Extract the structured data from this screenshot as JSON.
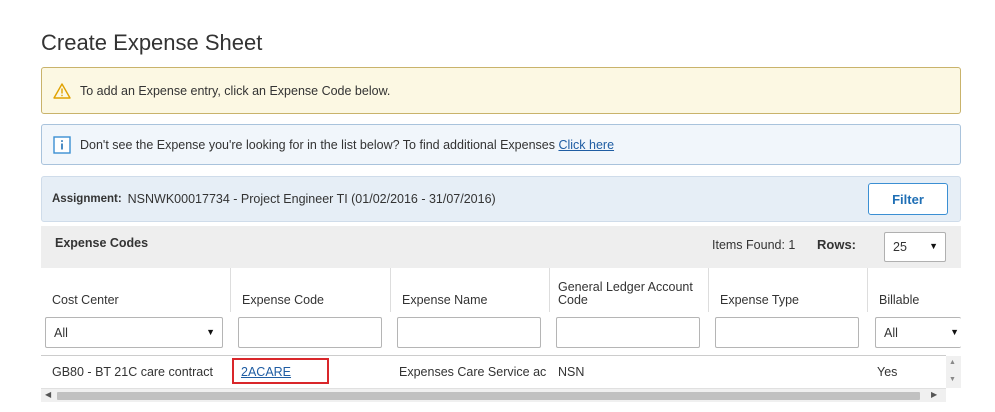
{
  "page_title": "Create Expense Sheet",
  "warning": {
    "icon": "warning-triangle-icon",
    "text": "To add an Expense entry, click an Expense Code below."
  },
  "info": {
    "icon": "info-icon",
    "text": "Don't see the Expense you're looking for in the list below? To find additional Expenses",
    "link": "Click here"
  },
  "assignment": {
    "label": "Assignment:",
    "value": "NSNWK00017734 - Project Engineer TI (01/02/2016 - 31/07/2016)",
    "filter_button": "Filter"
  },
  "codes": {
    "title": "Expense Codes",
    "items_found": "Items Found:  1",
    "rows_label": "Rows:",
    "rows_value": "25"
  },
  "columns": [
    "Cost Center",
    "Expense Code",
    "Expense Name",
    "General Ledger Account Code",
    "Expense Type",
    "Billable"
  ],
  "filters": {
    "cost_center": "All",
    "billable": "All"
  },
  "rows": [
    {
      "cost_center": "GB80 - BT 21C care contract",
      "expense_code": "2ACARE",
      "expense_name": "Expenses Care Service ac",
      "gl_code": "NSN",
      "expense_type": "",
      "billable": "Yes"
    }
  ],
  "colors": {
    "warning_bg": "#fcf8e3",
    "info_bg": "#f1f6fb",
    "link": "#1f5da3",
    "highlight": "#d9262a",
    "accent": "#3b8fd3"
  }
}
